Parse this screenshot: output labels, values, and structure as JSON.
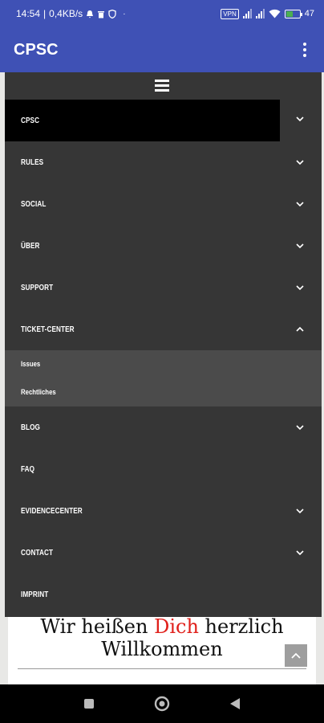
{
  "status_bar": {
    "time": "14:54",
    "net_speed": "0,4KB/s",
    "vpn_label": "VPN",
    "battery_level": "47"
  },
  "app_bar": {
    "title": "CPSC"
  },
  "menu": {
    "items": [
      {
        "label": "CPSC",
        "chevron": "down"
      },
      {
        "label": "RULES",
        "chevron": "down"
      },
      {
        "label": "SOCIAL",
        "chevron": "down"
      },
      {
        "label": "ÜBER",
        "chevron": "down"
      },
      {
        "label": "SUPPORT",
        "chevron": "down"
      },
      {
        "label": "TICKET-CENTER",
        "chevron": "up"
      },
      {
        "label": "BLOG",
        "chevron": "down"
      },
      {
        "label": "FAQ",
        "chevron": ""
      },
      {
        "label": "EVIDENCECENTER",
        "chevron": "down"
      },
      {
        "label": "CONTACT",
        "chevron": "down"
      },
      {
        "label": "IMPRINT",
        "chevron": ""
      }
    ],
    "submenu": [
      {
        "label": "Issues"
      },
      {
        "label": "Rechtliches"
      }
    ]
  },
  "page": {
    "welcome_part1": "Wir heißen ",
    "welcome_highlight": "Dich",
    "welcome_part2": " herzlich",
    "welcome_line2": "Willkommen",
    "highlight_color": "#e0201b"
  },
  "icons": {
    "menu_toggle": "hamburger-icon",
    "overflow": "kebab-menu-icon",
    "scroll_top": "chevron-up-icon"
  }
}
